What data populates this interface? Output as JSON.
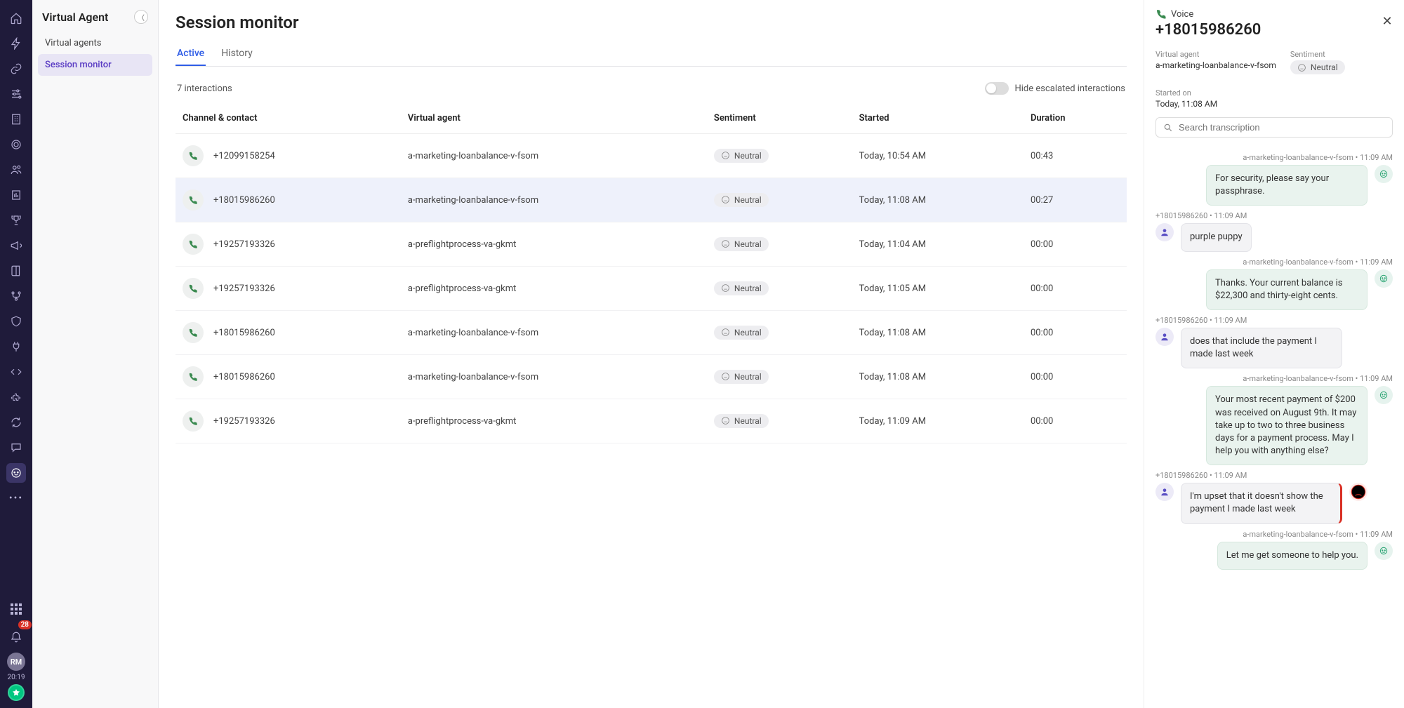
{
  "rail": {
    "notification_count": "28",
    "user_initials": "RM",
    "clock": "20:19"
  },
  "leftnav": {
    "title": "Virtual Agent",
    "items": [
      "Virtual agents",
      "Session monitor"
    ],
    "selected_index": 1
  },
  "page": {
    "title": "Session monitor",
    "tabs": [
      "Active",
      "History"
    ],
    "active_tab_index": 0,
    "count_label": "7 interactions",
    "toggle_label": "Hide escalated interactions"
  },
  "table": {
    "columns": [
      "Channel & contact",
      "Virtual agent",
      "Sentiment",
      "Started",
      "Duration"
    ],
    "rows": [
      {
        "contact": "+12099158254",
        "agent": "a-marketing-loanbalance-v-fsom",
        "sentiment": "Neutral",
        "started": "Today, 10:54 AM",
        "duration": "00:43",
        "selected": false
      },
      {
        "contact": "+18015986260",
        "agent": "a-marketing-loanbalance-v-fsom",
        "sentiment": "Neutral",
        "started": "Today, 11:08 AM",
        "duration": "00:27",
        "selected": true
      },
      {
        "contact": "+19257193326",
        "agent": "a-preflightprocess-va-gkmt",
        "sentiment": "Neutral",
        "started": "Today, 11:04 AM",
        "duration": "00:00",
        "selected": false
      },
      {
        "contact": "+19257193326",
        "agent": "a-preflightprocess-va-gkmt",
        "sentiment": "Neutral",
        "started": "Today, 11:05 AM",
        "duration": "00:00",
        "selected": false
      },
      {
        "contact": "+18015986260",
        "agent": "a-marketing-loanbalance-v-fsom",
        "sentiment": "Neutral",
        "started": "Today, 11:08 AM",
        "duration": "00:00",
        "selected": false
      },
      {
        "contact": "+18015986260",
        "agent": "a-marketing-loanbalance-v-fsom",
        "sentiment": "Neutral",
        "started": "Today, 11:08 AM",
        "duration": "00:00",
        "selected": false
      },
      {
        "contact": "+19257193326",
        "agent": "a-preflightprocess-va-gkmt",
        "sentiment": "Neutral",
        "started": "Today, 11:09 AM",
        "duration": "00:00",
        "selected": false
      }
    ]
  },
  "panel": {
    "channel_label": "Voice",
    "title": "+18015986260",
    "meta": {
      "virtual_agent_label": "Virtual agent",
      "virtual_agent_value": "a-marketing-loanbalance-v-fsom",
      "sentiment_label": "Sentiment",
      "sentiment_value": "Neutral",
      "started_label": "Started on",
      "started_value": "Today, 11:08 AM"
    },
    "search_placeholder": "Search transcription",
    "messages": [
      {
        "side": "agent",
        "meta": "a-marketing-loanbalance-v-fsom • 11:09 AM",
        "text": "For security, please say your passphrase.",
        "neg": false
      },
      {
        "side": "user",
        "meta": "+18015986260 • 11:09 AM",
        "text": "purple puppy",
        "neg": false
      },
      {
        "side": "agent",
        "meta": "a-marketing-loanbalance-v-fsom • 11:09 AM",
        "text": "Thanks. Your current balance is $22,300 and thirty-eight cents.",
        "neg": false
      },
      {
        "side": "user",
        "meta": "+18015986260 • 11:09 AM",
        "text": "does that include the payment I made last week",
        "neg": false
      },
      {
        "side": "agent",
        "meta": "a-marketing-loanbalance-v-fsom • 11:09 AM",
        "text": "Your most recent payment of $200 was received on August 9th. It may take up to two to three business days for a payment process. May I help you with anything else?",
        "neg": false
      },
      {
        "side": "user",
        "meta": "+18015986260 • 11:09 AM",
        "text": "I'm upset that it doesn't show the payment I made last week",
        "neg": true
      },
      {
        "side": "agent",
        "meta": "a-marketing-loanbalance-v-fsom • 11:09 AM",
        "text": "Let me get someone to help you.",
        "neg": false
      }
    ]
  }
}
